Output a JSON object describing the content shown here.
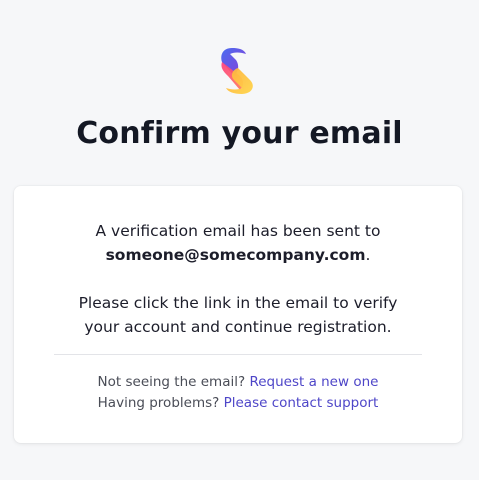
{
  "logo": {
    "icon": "brand-s-logo-icon",
    "colors": [
      "#5b4fd6",
      "#ff4d8d",
      "#ffc83d"
    ]
  },
  "page": {
    "title": "Confirm your email"
  },
  "card": {
    "sent_prefix": "A verification email has been sent to",
    "email": "someone@somecompany.com",
    "email_suffix": ".",
    "instruction_line1": "Please click the link in the email to verify",
    "instruction_line2": "your account and continue registration.",
    "resend_prompt": "Not seeing the email?",
    "resend_link": "Request a new one",
    "support_prompt": "Having problems?",
    "support_link": "Please contact support"
  },
  "colors": {
    "link": "#4e46c8",
    "background": "#f6f7f9",
    "card": "#ffffff"
  }
}
